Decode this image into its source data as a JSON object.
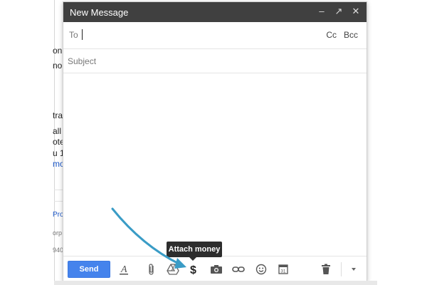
{
  "background_page": {
    "fragments": [
      "on",
      "no",
      "tra",
      "all",
      "ote",
      "u 1",
      "mo",
      "Pro",
      "orp",
      "940"
    ]
  },
  "compose": {
    "title": "New Message",
    "window_controls": {
      "minimize": "–",
      "popout": "↗",
      "close": "✕"
    },
    "to_label": "To",
    "cc_label": "Cc",
    "bcc_label": "Bcc",
    "subject_placeholder": "Subject",
    "subject_value": "",
    "toolbar": {
      "send_label": "Send",
      "tooltip": "Attach money"
    }
  },
  "colors": {
    "titlebar": "#404040",
    "send_button": "#4583ec",
    "tooltip_bg": "#2d2d2d",
    "annotation_arrow": "#3a9cc6",
    "link_blue": "#1a56c7"
  },
  "icons": [
    "formatting-icon",
    "paperclip-icon",
    "drive-icon",
    "dollar-icon",
    "camera-icon",
    "link-icon",
    "emoji-icon",
    "calendar-icon",
    "trash-icon",
    "more-options-icon"
  ]
}
